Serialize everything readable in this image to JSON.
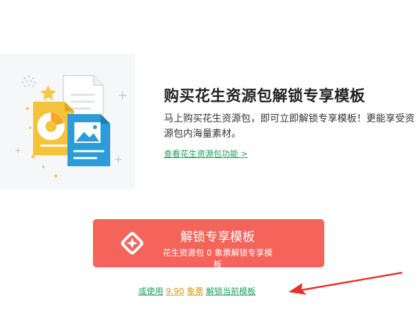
{
  "promo": {
    "headline": "购买花生资源包解锁专享模板",
    "description": "马上购买花生资源包，即可立即解锁专享模板！更能享受资源包内海量素材。",
    "details_link": "查看花生资源包功能 >"
  },
  "unlock_button": {
    "title": "解锁专享模板",
    "subtitle": "花生资源包 0 象票解锁专享模板"
  },
  "alternative": {
    "prefix": "或使用",
    "amount": "9.90",
    "unit": "象票",
    "action": "解锁当前模板"
  },
  "colors": {
    "accent_green": "#19a15f",
    "button_red": "#f4645a",
    "amount_gold": "#d99a15"
  },
  "icons": [
    "document-illustration",
    "star-badge-icon",
    "annotation-arrow"
  ]
}
